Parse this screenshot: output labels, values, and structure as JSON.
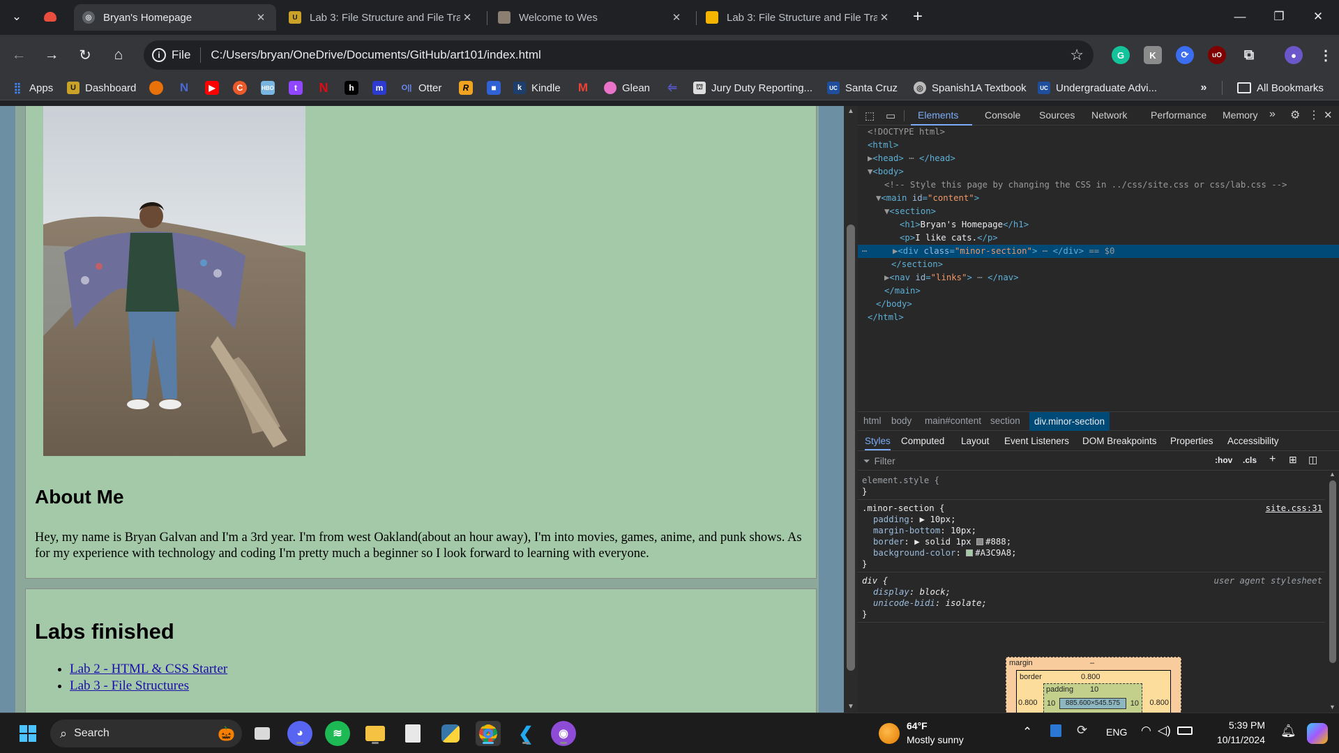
{
  "tabs": [
    {
      "title": "Bryan's Homepage",
      "active": true,
      "icon": "globe-icon"
    },
    {
      "title": "Lab 3: File Structure and File Tra",
      "active": false,
      "icon": "ucsc-icon"
    },
    {
      "title": "Welcome to Wes",
      "active": false,
      "icon": "site-icon"
    },
    {
      "title": "Lab 3: File Structure and File Tra",
      "active": false,
      "icon": "slides-icon"
    }
  ],
  "omnibox": {
    "scheme_label": "File",
    "url": "C:/Users/bryan/OneDrive/Documents/GitHub/art101/index.html"
  },
  "bookmarks": {
    "apps": "Apps",
    "dashboard": "Dashboard",
    "otter": "Otter",
    "kindle": "Kindle",
    "glean": "Glean",
    "jury": "Jury Duty Reporting...",
    "santacruz": "Santa Cruz",
    "spanish": "Spanish1A Textbook",
    "undergrad": "Undergraduate Advi...",
    "all": "All Bookmarks"
  },
  "page": {
    "about_heading": "About Me",
    "about_text": "Hey, my name is Bryan Galvan and I'm a 3rd year. I'm from west Oakland(about an hour away), I'm into movies, games, anime, and punk shows. As for my experience with technology and coding I'm pretty much a beginner so I look forward to learning with everyone.",
    "labs_heading": "Labs finished",
    "labs": [
      "Lab 2 - HTML & CSS Starter",
      "Lab 3 - File Structures"
    ]
  },
  "devtools": {
    "tabs": [
      "Elements",
      "Console",
      "Sources",
      "Network",
      "Performance",
      "Memory"
    ],
    "active_tab": "Elements",
    "dom": {
      "doctype": "<!DOCTYPE html>",
      "comment": "<!-- Style this page by changing the CSS in ../css/site.css or css/lab.css -->",
      "h1_text": "Bryan's Homepage",
      "p_text": "I like cats.",
      "main_id": "\"content\"",
      "div_class": "\"minor-section\"",
      "nav_id": "\"links\"",
      "selected_suffix": "== $0"
    },
    "breadcrumbs": [
      "html",
      "body",
      "main#content",
      "section",
      "div.minor-section"
    ],
    "subtabs": [
      "Styles",
      "Computed",
      "Layout",
      "Event Listeners",
      "DOM Breakpoints",
      "Properties",
      "Accessibility"
    ],
    "filter_placeholder": "Filter",
    "hov": ":hov",
    "cls": ".cls",
    "styles": {
      "element_style": "element.style {",
      "rule1_selector": ".minor-section {",
      "rule1_source": "site.css:31",
      "padding": "10px;",
      "margin_bottom": "10px;",
      "border": "solid 1px",
      "border_color": "#888;",
      "background_color": "#A3C9A8;",
      "rule2_selector": "div {",
      "rule2_source": "user agent stylesheet",
      "display": "block;",
      "unicode_bidi": "isolate;"
    },
    "boxmodel": {
      "margin_label": "margin",
      "margin_value": "–",
      "border_label": "border",
      "border_value": "0.800",
      "padding_label": "padding",
      "padding_value": "10",
      "content": "885.600×545.575",
      "side_border": "0.800",
      "side_padding": "10"
    }
  },
  "taskbar": {
    "search": "Search",
    "weather_temp": "64°F",
    "weather_desc": "Mostly sunny",
    "lang": "ENG",
    "time": "5:39 PM",
    "date": "10/11/2024"
  },
  "colors": {
    "page_bg": "#6d8fa3",
    "section_bg": "#A3C9A8",
    "devtools_selected": "#004a77"
  }
}
